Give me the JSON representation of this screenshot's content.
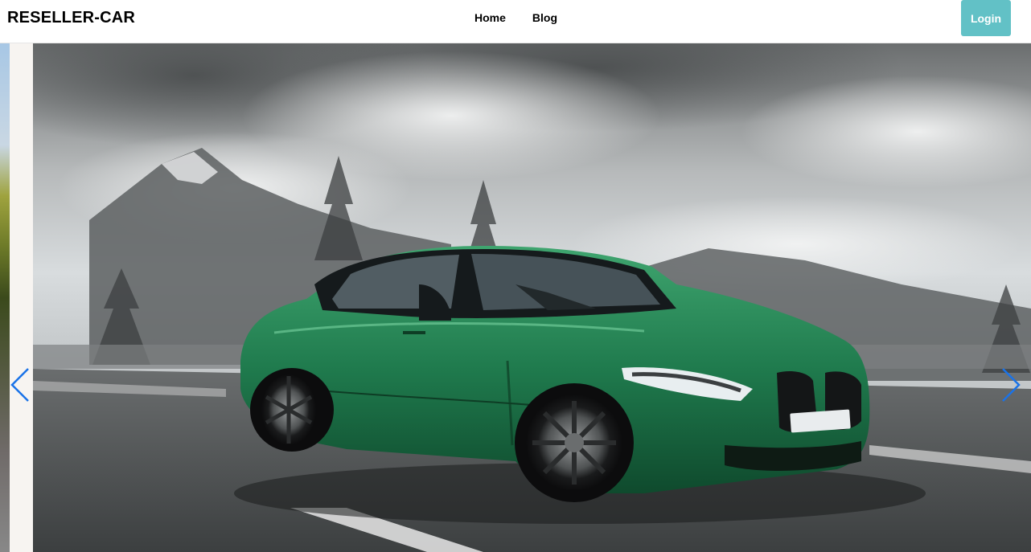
{
  "brand": {
    "name": "RESELLER-CAR"
  },
  "nav": {
    "items": [
      {
        "label": "Home"
      },
      {
        "label": "Blog"
      }
    ]
  },
  "login": {
    "label": "Login"
  },
  "colors": {
    "login_button": "#62c1c6",
    "arrow": "#1a73e8",
    "car_green": "#1f7a4d"
  },
  "carousel": {
    "prev_icon": "chevron-left-icon",
    "next_icon": "chevron-right-icon",
    "slide_subject": "green-sedan-photo"
  }
}
